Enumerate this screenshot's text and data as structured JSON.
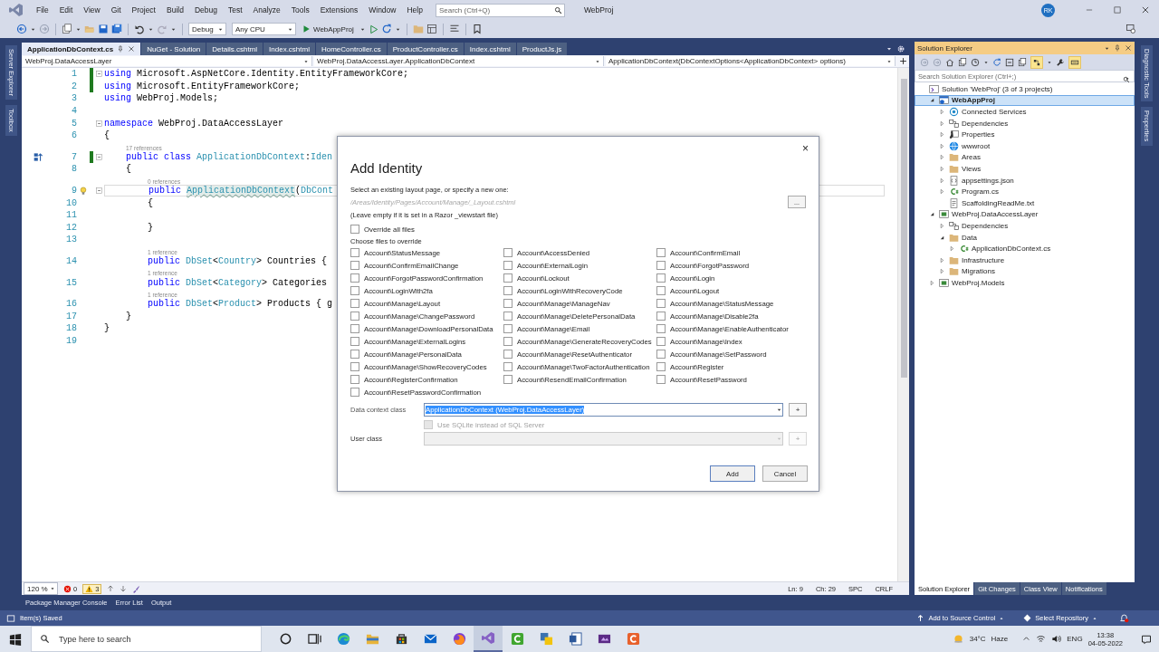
{
  "menu_bar": {
    "items": [
      "File",
      "Edit",
      "View",
      "Git",
      "Project",
      "Build",
      "Debug",
      "Test",
      "Analyze",
      "Tools",
      "Extensions",
      "Window",
      "Help"
    ],
    "search": {
      "placeholder": "Search (Ctrl+Q)"
    },
    "solution_name": "WebProj",
    "avatar": "RK"
  },
  "toolbar": {
    "configuration": "Debug",
    "platform": "Any CPU",
    "start_target": "WebAppProj"
  },
  "left_tool_strip": [
    "Server Explorer",
    "Toolbox"
  ],
  "right_tool_strip": [
    "Diagnostic Tools",
    "Properties"
  ],
  "editor": {
    "tabs": [
      {
        "label": "ApplicationDbContext.cs",
        "selected": true
      },
      {
        "label": "NuGet - Solution",
        "selected": false
      },
      {
        "label": "Details.cshtml",
        "selected": false
      },
      {
        "label": "Index.cshtml",
        "selected": false
      },
      {
        "label": "HomeController.cs",
        "selected": false
      },
      {
        "label": "ProductController.cs",
        "selected": false
      },
      {
        "label": "Index.cshtml",
        "selected": false
      },
      {
        "label": "ProductJs.js",
        "selected": false
      }
    ],
    "nav": [
      "WebProj.DataAccessLayer",
      "WebProj.DataAccessLayer.ApplicationDbContext",
      "ApplicationDbContext(DbContextOptions<ApplicationDbContext> options)"
    ],
    "lines": [
      {
        "number": "1",
        "changed": true,
        "fold": true,
        "current": false,
        "tokens": [
          {
            "text": "using",
            "kind": "kw"
          },
          {
            "text": " Microsoft.AspNetCore.Identity.EntityFrameworkCore;",
            "kind": "plain"
          }
        ]
      },
      {
        "number": "2",
        "changed": true,
        "fold": false,
        "current": false,
        "tokens": [
          {
            "text": "using",
            "kind": "kw"
          },
          {
            "text": " Microsoft.EntityFrameworkCore;",
            "kind": "plain"
          }
        ]
      },
      {
        "number": "3",
        "changed": false,
        "fold": false,
        "current": false,
        "tokens": [
          {
            "text": "using",
            "kind": "kw"
          },
          {
            "text": " WebProj.Models;",
            "kind": "plain"
          }
        ]
      },
      {
        "number": "4",
        "changed": false,
        "fold": false,
        "current": false
      },
      {
        "number": "5",
        "changed": false,
        "fold": true,
        "current": false,
        "tokens": [
          {
            "text": "namespace",
            "kind": "kw"
          },
          {
            "text": " WebProj.DataAccessLayer",
            "kind": "plain"
          }
        ]
      },
      {
        "number": "6",
        "changed": false,
        "fold": false,
        "current": false,
        "tokens": [
          {
            "text": "{",
            "kind": "plain"
          }
        ]
      },
      {
        "number": "7",
        "changed": true,
        "fold": true,
        "current": false,
        "codelens": "17 references",
        "tokens": [
          {
            "text": "    public class ",
            "kind": "kw"
          },
          {
            "text": "ApplicationDbContext",
            "kind": "type"
          },
          {
            "text": ":",
            "kind": "plain"
          },
          {
            "text": "Iden",
            "kind": "type"
          }
        ]
      },
      {
        "number": "8",
        "changed": false,
        "fold": false,
        "current": false,
        "tokens": [
          {
            "text": "    {",
            "kind": "plain"
          }
        ]
      },
      {
        "number": "9",
        "changed": false,
        "fold": true,
        "current": true,
        "codelens": "0 references",
        "tokens": [
          {
            "text": "        public ",
            "kind": "kw"
          },
          {
            "text": "ApplicationDbContext",
            "kind": "ref"
          },
          {
            "text": "(",
            "kind": "plain"
          },
          {
            "text": "DbCont",
            "kind": "type"
          }
        ]
      },
      {
        "number": "10",
        "changed": false,
        "fold": false,
        "current": false,
        "tokens": [
          {
            "text": "        {",
            "kind": "plain"
          }
        ]
      },
      {
        "number": "11",
        "changed": false,
        "fold": false,
        "current": false
      },
      {
        "number": "12",
        "changed": false,
        "fold": false,
        "current": false,
        "tokens": [
          {
            "text": "        }",
            "kind": "plain"
          }
        ]
      },
      {
        "number": "13",
        "changed": false,
        "fold": false,
        "current": false
      },
      {
        "number": "14",
        "changed": false,
        "fold": false,
        "current": false,
        "codelens": "1 reference",
        "tokens": [
          {
            "text": "        public ",
            "kind": "kw"
          },
          {
            "text": "DbSet",
            "kind": "type"
          },
          {
            "text": "<",
            "kind": "plain"
          },
          {
            "text": "Country",
            "kind": "type"
          },
          {
            "text": "> Countries {",
            "kind": "plain"
          }
        ]
      },
      {
        "number": "15",
        "changed": false,
        "fold": false,
        "current": false,
        "codelens": "1 reference",
        "tokens": [
          {
            "text": "        public ",
            "kind": "kw"
          },
          {
            "text": "DbSet",
            "kind": "type"
          },
          {
            "text": "<",
            "kind": "plain"
          },
          {
            "text": "Category",
            "kind": "type"
          },
          {
            "text": "> Categories",
            "kind": "plain"
          }
        ]
      },
      {
        "number": "16",
        "changed": false,
        "fold": false,
        "current": false,
        "codelens": "1 reference",
        "tokens": [
          {
            "text": "        public ",
            "kind": "kw"
          },
          {
            "text": "DbSet",
            "kind": "type"
          },
          {
            "text": "<",
            "kind": "plain"
          },
          {
            "text": "Product",
            "kind": "type"
          },
          {
            "text": "> Products { g",
            "kind": "plain"
          }
        ]
      },
      {
        "number": "17",
        "changed": false,
        "fold": false,
        "current": false,
        "tokens": [
          {
            "text": "    }",
            "kind": "plain"
          }
        ]
      },
      {
        "number": "18",
        "changed": false,
        "fold": false,
        "current": false,
        "tokens": [
          {
            "text": "}",
            "kind": "plain"
          }
        ]
      },
      {
        "number": "19",
        "changed": false,
        "fold": false,
        "current": false
      }
    ],
    "zoom": "120 %",
    "errors": "0",
    "warnings": "3",
    "position": [
      "Ln: 9",
      "Ch: 29",
      "SPC",
      "CRLF"
    ]
  },
  "solution_explorer": {
    "title": "Solution Explorer",
    "search": {
      "placeholder": "Search Solution Explorer (Ctrl+;)"
    },
    "tree": [
      {
        "label": "Solution 'WebProj' (3 of 3 projects)",
        "kind": "solution",
        "selected": false,
        "children": [
          {
            "label": "WebAppProj",
            "kind": "webproject",
            "selected": true,
            "expanded": true,
            "children": [
              {
                "label": "Connected Services",
                "kind": "connected",
                "selected": false,
                "expanded": false
              },
              {
                "label": "Dependencies",
                "kind": "dependencies",
                "selected": false,
                "expanded": false
              },
              {
                "label": "Properties",
                "kind": "properties",
                "selected": false,
                "expanded": false
              },
              {
                "label": "wwwroot",
                "kind": "web",
                "selected": false,
                "expanded": false
              },
              {
                "label": "Areas",
                "kind": "folder",
                "selected": false,
                "expanded": false
              },
              {
                "label": "Views",
                "kind": "folder",
                "selected": false,
                "expanded": false
              },
              {
                "label": "appsettings.json",
                "kind": "json",
                "selected": false,
                "expanded": false
              },
              {
                "label": "Program.cs",
                "kind": "csharp",
                "selected": false,
                "expanded": false
              },
              {
                "label": "ScaffoldingReadMe.txt",
                "kind": "text",
                "selected": false
              }
            ]
          },
          {
            "label": "WebProj.DataAccessLayer",
            "kind": "project",
            "selected": false,
            "expanded": true,
            "children": [
              {
                "label": "Dependencies",
                "kind": "dependencies",
                "selected": false,
                "expanded": false
              },
              {
                "label": "Data",
                "kind": "folder",
                "selected": false,
                "expanded": true,
                "children": [
                  {
                    "label": "ApplicationDbContext.cs",
                    "kind": "csharp",
                    "selected": false,
                    "expanded": false
                  }
                ]
              },
              {
                "label": "Infrastructure",
                "kind": "folder",
                "selected": false,
                "expanded": false
              },
              {
                "label": "Migrations",
                "kind": "folder",
                "selected": false,
                "expanded": false
              }
            ]
          },
          {
            "label": "WebProj.Models",
            "kind": "project",
            "selected": false,
            "expanded": false
          }
        ]
      }
    ],
    "tabs": [
      {
        "label": "Solution Explorer",
        "selected": true
      },
      {
        "label": "Git Changes",
        "selected": false
      },
      {
        "label": "Class View",
        "selected": false
      },
      {
        "label": "Notifications",
        "selected": false
      }
    ]
  },
  "bottom_tool_tabs": [
    "Package Manager Console",
    "Error List",
    "Output"
  ],
  "status_bar": {
    "message": "Item(s) Saved",
    "source_control": "Add to Source Control",
    "repository": "Select Repository"
  },
  "taskbar": {
    "search": {
      "placeholder": "Type here to search"
    },
    "apps": [
      {
        "kind": "cortana",
        "selected": false
      },
      {
        "kind": "taskview",
        "selected": false
      },
      {
        "kind": "browser",
        "selected": false
      },
      {
        "kind": "explorer",
        "selected": false
      },
      {
        "kind": "store",
        "selected": false
      },
      {
        "kind": "mail",
        "selected": false
      },
      {
        "kind": "globe",
        "selected": false
      },
      {
        "kind": "ide",
        "selected": true
      },
      {
        "kind": "recorder",
        "selected": false
      },
      {
        "kind": "tiles",
        "selected": false
      },
      {
        "kind": "document",
        "selected": false
      },
      {
        "kind": "media",
        "selected": false
      },
      {
        "kind": "square",
        "selected": false
      }
    ],
    "temperature": "34°C",
    "weather": "Haze",
    "language": "ENG",
    "time": "13:38",
    "date": "04-05-2022"
  },
  "dialog": {
    "title": "Add Identity",
    "layout_label": "Select an existing layout page, or specify a new one:",
    "layout_field": {
      "placeholder": "/Areas/Identity/Pages/Account/Manage/_Layout.cshtml"
    },
    "browse_button": "...",
    "layout_hint": "(Leave empty if it is set in a Razor _viewstart file)",
    "override_all": {
      "label": "Override all files",
      "checked": false
    },
    "files_label": "Choose files to override",
    "files": [
      {
        "label": "Account\\StatusMessage",
        "checked": false
      },
      {
        "label": "Account\\AccessDenied",
        "checked": false
      },
      {
        "label": "Account\\ConfirmEmail",
        "checked": false
      },
      {
        "label": "Account\\ConfirmEmailChange",
        "checked": false
      },
      {
        "label": "Account\\ExternalLogin",
        "checked": false
      },
      {
        "label": "Account\\ForgotPassword",
        "checked": false
      },
      {
        "label": "Account\\ForgotPasswordConfirmation",
        "checked": false
      },
      {
        "label": "Account\\Lockout",
        "checked": false
      },
      {
        "label": "Account\\Login",
        "checked": false
      },
      {
        "label": "Account\\LoginWith2fa",
        "checked": false
      },
      {
        "label": "Account\\LoginWithRecoveryCode",
        "checked": false
      },
      {
        "label": "Account\\Logout",
        "checked": false
      },
      {
        "label": "Account\\Manage\\Layout",
        "checked": false
      },
      {
        "label": "Account\\Manage\\ManageNav",
        "checked": false
      },
      {
        "label": "Account\\Manage\\StatusMessage",
        "checked": false
      },
      {
        "label": "Account\\Manage\\ChangePassword",
        "checked": false
      },
      {
        "label": "Account\\Manage\\DeletePersonalData",
        "checked": false
      },
      {
        "label": "Account\\Manage\\Disable2fa",
        "checked": false
      },
      {
        "label": "Account\\Manage\\DownloadPersonalData",
        "checked": false
      },
      {
        "label": "Account\\Manage\\Email",
        "checked": false
      },
      {
        "label": "Account\\Manage\\EnableAuthenticator",
        "checked": false
      },
      {
        "label": "Account\\Manage\\ExternalLogins",
        "checked": false
      },
      {
        "label": "Account\\Manage\\GenerateRecoveryCodes",
        "checked": false
      },
      {
        "label": "Account\\Manage\\Index",
        "checked": false
      },
      {
        "label": "Account\\Manage\\PersonalData",
        "checked": false
      },
      {
        "label": "Account\\Manage\\ResetAuthenticator",
        "checked": false
      },
      {
        "label": "Account\\Manage\\SetPassword",
        "checked": false
      },
      {
        "label": "Account\\Manage\\ShowRecoveryCodes",
        "checked": false
      },
      {
        "label": "Account\\Manage\\TwoFactorAuthentication",
        "checked": false
      },
      {
        "label": "Account\\Register",
        "checked": false
      },
      {
        "label": "Account\\RegisterConfirmation",
        "checked": false
      },
      {
        "label": "Account\\ResendEmailConfirmation",
        "checked": false
      },
      {
        "label": "Account\\ResetPassword",
        "checked": false
      },
      {
        "label": "Account\\ResetPasswordConfirmation",
        "checked": false
      }
    ],
    "data_context": {
      "label": "Data context class",
      "value": "ApplicationDbContext (WebProj.DataAccessLayer)",
      "selected": true
    },
    "add_context_button": "+",
    "sqlite": {
      "label": "Use SQLite instead of SQL Server",
      "checked": false,
      "disabled": true
    },
    "user_class": {
      "label": "User class",
      "disabled": true
    },
    "add_user_button": {
      "label": "+",
      "disabled": true
    },
    "buttons": [
      {
        "label": "Add",
        "kind": "primary"
      },
      {
        "label": "Cancel",
        "kind": "secondary"
      }
    ],
    "close": "×"
  }
}
